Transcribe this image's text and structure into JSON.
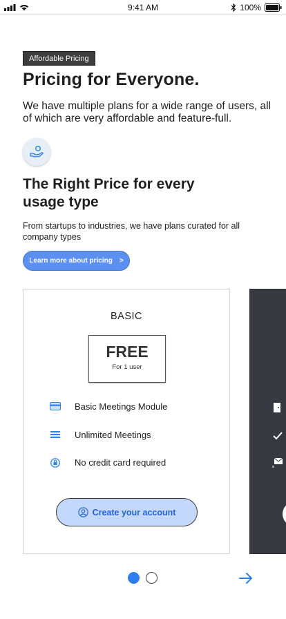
{
  "status_bar": {
    "time": "9:41 AM",
    "battery": "100%"
  },
  "hero": {
    "tag": "Affordable Pricing",
    "title": "Pricing for Everyone.",
    "lead": "We have multiple plans for a wide range of users, all of which are very affordable and  feature-full."
  },
  "section": {
    "icon": "hand-coin-icon",
    "title": "The Right Price for every usage type",
    "subtitle": "From startups to industries, we have plans curated for all company types",
    "learn_label": "Learn more about pricing",
    "learn_chevron": ">"
  },
  "plan": {
    "name": "BASIC",
    "price": "FREE",
    "price_note": "For 1 user",
    "features": [
      {
        "label": "Basic Meetings Module",
        "icon": "credit-card-icon"
      },
      {
        "label": "Unlimited Meetings",
        "icon": "list-lines-icon"
      },
      {
        "label": "No credit card required",
        "icon": "lock-badge-icon"
      }
    ],
    "cta": "Create your account"
  },
  "pager": {
    "page_count": 2,
    "active_index": 0
  },
  "colors": {
    "accent": "#2d7ff0",
    "button": "#5b90f0",
    "cta_bg": "#c3d8fb",
    "dark_card": "#363a40"
  }
}
